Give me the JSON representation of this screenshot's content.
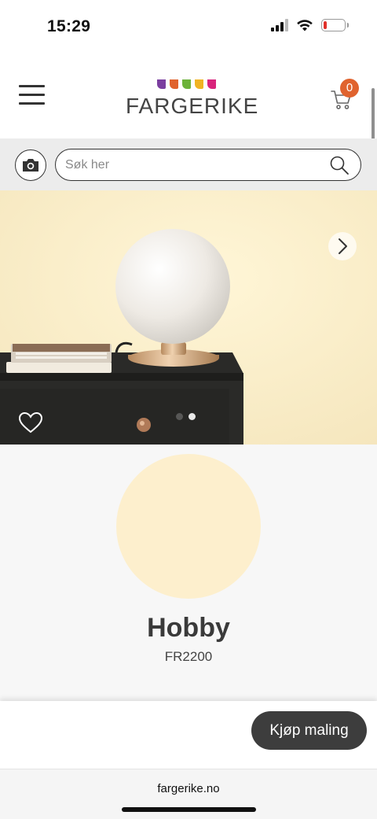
{
  "status_bar": {
    "time": "15:29",
    "icons": [
      "signal-icon",
      "wifi-icon",
      "battery-icon"
    ],
    "battery_level": 0.15,
    "battery_color": "#e0302a"
  },
  "header": {
    "logo_text": "FARGERIKE",
    "logo_colors": [
      "#7b3fa0",
      "#e0632e",
      "#6cb23a",
      "#f0b323",
      "#d8247c"
    ],
    "menu_icon": "hamburger-menu-icon",
    "cart_icon": "shopping-cart-icon",
    "cart_count": "0",
    "badge_color": "#e0632e"
  },
  "search": {
    "placeholder": "Søk her",
    "value": "",
    "camera_icon": "camera-icon",
    "search_icon": "search-icon"
  },
  "hero": {
    "next_icon": "chevron-right-icon",
    "favorite_icon": "heart-icon",
    "carousel_total": 2,
    "carousel_active": 2
  },
  "color": {
    "name": "Hobby",
    "code": "FR2200",
    "swatch_hex": "#fdefcd"
  },
  "actions": {
    "buy_label": "Kjøp maling"
  },
  "browser": {
    "url": "fargerike.no"
  }
}
